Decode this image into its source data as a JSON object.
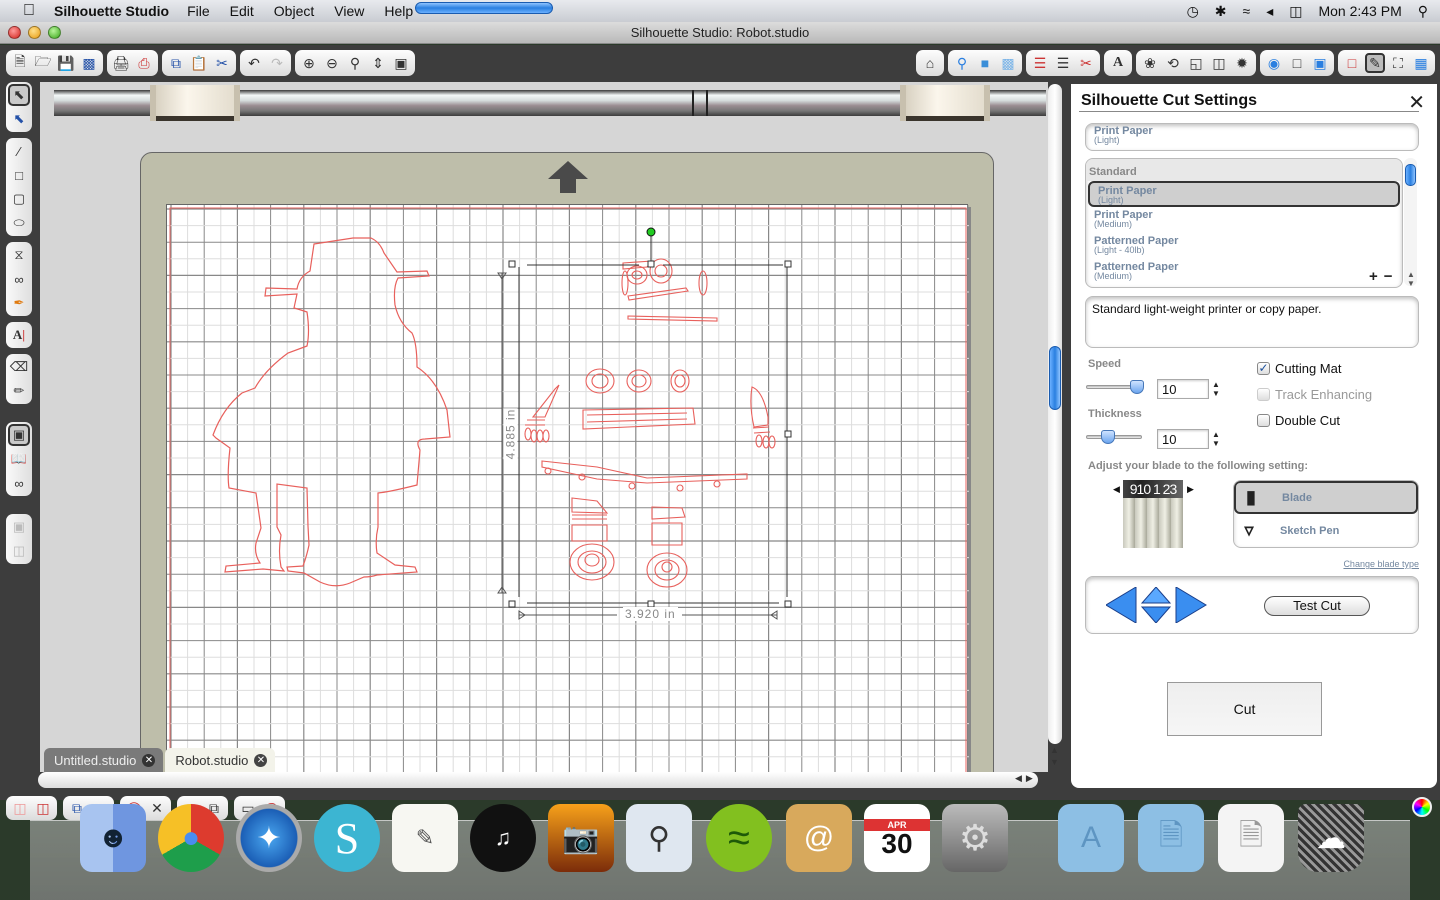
{
  "menubar": {
    "app_name": "Silhouette Studio",
    "menus": [
      "File",
      "Edit",
      "Object",
      "View",
      "Help"
    ],
    "clock": "Mon 2:43 PM"
  },
  "window": {
    "title": "Silhouette Studio: Robot.studio"
  },
  "toolbar_left": [
    [
      "new-document",
      "open-file",
      "save",
      "save-to-library"
    ],
    [
      "print",
      "print-and-cut"
    ],
    [
      "copy",
      "paste",
      "cut"
    ],
    [
      "undo",
      "redo"
    ],
    [
      "zoom-in",
      "zoom-out",
      "zoom-select",
      "pan",
      "fit-to-page"
    ]
  ],
  "toolbar_right": [
    [
      "library"
    ],
    [
      "fill-color",
      "fill-gradient",
      "fill-pattern"
    ],
    [
      "line-color",
      "line-style",
      "cut-style"
    ],
    [
      "text-style"
    ],
    [
      "replicate",
      "rotate",
      "scale",
      "align",
      "modify"
    ],
    [
      "trace",
      "page-setup",
      "registration-marks"
    ],
    [
      "page-border",
      "design-mode",
      "fullscreen",
      "grid"
    ]
  ],
  "tabs": [
    {
      "label": "Untitled.studio",
      "active": false
    },
    {
      "label": "Robot.studio",
      "active": true
    }
  ],
  "selection": {
    "width": "3.920 in",
    "height": "4.885 in"
  },
  "cut_panel": {
    "title": "Silhouette Cut Settings",
    "selected_material": {
      "name": "Print Paper",
      "sub": "(Light)"
    },
    "material_group": "Standard",
    "materials": [
      {
        "name": "Print Paper",
        "sub": "(Light)",
        "selected": true
      },
      {
        "name": "Print Paper",
        "sub": "(Medium)",
        "selected": false
      },
      {
        "name": "Patterned Paper",
        "sub": "(Light - 40lb)",
        "selected": false
      },
      {
        "name": "Patterned Paper",
        "sub": "(Medium)",
        "selected": false
      }
    ],
    "add_label": "+",
    "remove_label": "−",
    "description": "Standard light-weight printer or copy paper.",
    "speed_label": "Speed",
    "speed_value": "10",
    "speed_level": 1.0,
    "thickness_label": "Thickness",
    "thickness_value": "10",
    "thickness_level": 0.33,
    "checkboxes": [
      {
        "label": "Cutting Mat",
        "checked": true,
        "disabled": false
      },
      {
        "label": "Track Enhancing",
        "checked": false,
        "disabled": true
      },
      {
        "label": "Double Cut",
        "checked": false,
        "disabled": false
      }
    ],
    "blade_instruction": "Adjust your blade to the following setting:",
    "blade_dial": "910 1 23",
    "tool_types": [
      {
        "label": "Blade",
        "selected": true
      },
      {
        "label": "Sketch Pen",
        "selected": false
      }
    ],
    "change_blade_link": "Change blade type",
    "test_cut_label": "Test Cut",
    "cut_label": "Cut"
  },
  "dock": {
    "calendar_month": "APR",
    "calendar_day": "30",
    "apps": [
      "Finder",
      "Chrome",
      "Safari",
      "Silhouette Studio",
      "TextEdit",
      "Dashboard",
      "iPhoto",
      "Preview",
      "Spotify",
      "Address Book",
      "iCal",
      "System Preferences",
      "Applications",
      "Documents",
      "Downloads",
      "Trash"
    ]
  }
}
